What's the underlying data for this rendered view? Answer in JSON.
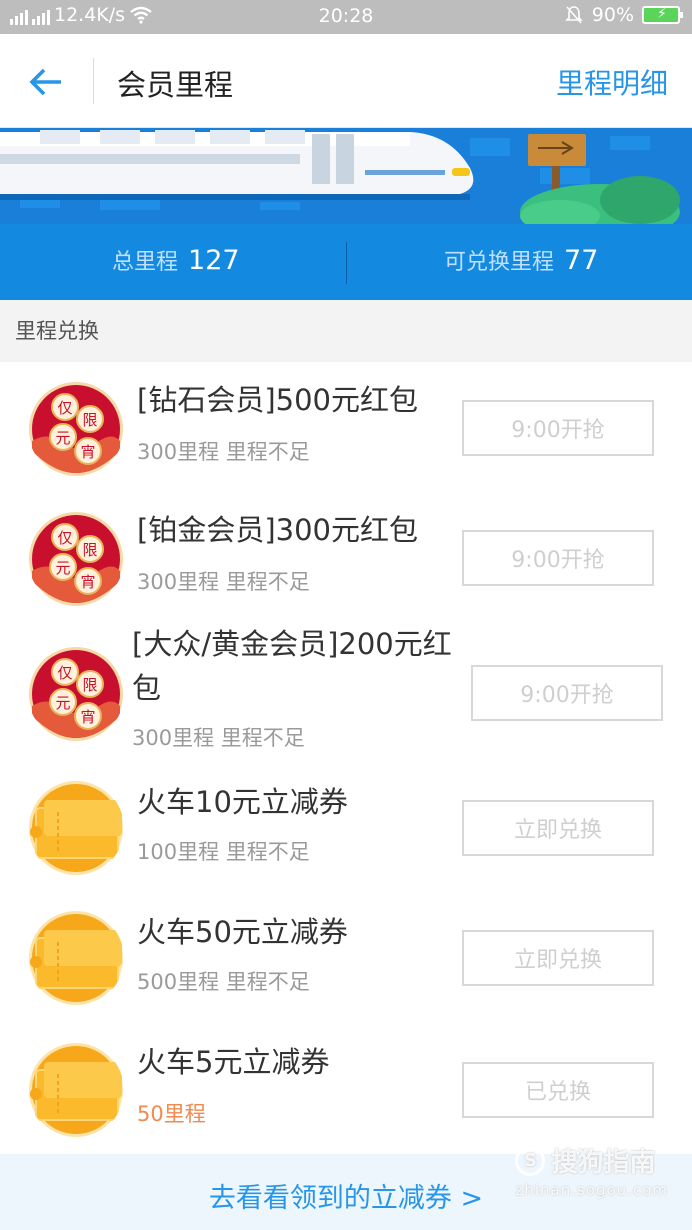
{
  "status_bar": {
    "network_1": "4G",
    "network_2": "2G",
    "speed": "12.4K/s",
    "time": "20:28",
    "battery": "90%"
  },
  "header": {
    "title": "会员里程",
    "detail_link": "里程明细"
  },
  "stats": {
    "total_label": "总里程",
    "total_value": "127",
    "exchangeable_label": "可兑换里程",
    "exchangeable_value": "77"
  },
  "section": {
    "title": "里程兑换"
  },
  "items": [
    {
      "name": "[钻石会员]500元红包",
      "miles": "300里程",
      "status": "里程不足",
      "button": "9:00开抢",
      "badge_icon": "red-envelope-badge",
      "badge_chars": [
        "仅",
        "限",
        "元",
        "宵"
      ]
    },
    {
      "name": "[铂金会员]300元红包",
      "miles": "300里程",
      "status": "里程不足",
      "button": "9:00开抢",
      "badge_icon": "red-envelope-badge",
      "badge_chars": [
        "仅",
        "限",
        "元",
        "宵"
      ]
    },
    {
      "name": "[大众/黄金会员]200元红包",
      "miles": "300里程",
      "status": "里程不足",
      "button": "9:00开抢",
      "badge_icon": "red-envelope-badge",
      "badge_chars": [
        "仅",
        "限",
        "元",
        "宵"
      ]
    },
    {
      "name": "火车10元立减券",
      "miles": "100里程",
      "status": "里程不足",
      "button": "立即兑换",
      "badge_icon": "ticket-coupon-badge"
    },
    {
      "name": "火车50元立减券",
      "miles": "500里程",
      "status": "里程不足",
      "button": "立即兑换",
      "badge_icon": "ticket-coupon-badge"
    },
    {
      "name": "火车5元立减券",
      "miles": "50里程",
      "status": "",
      "button": "已兑换",
      "badge_icon": "ticket-coupon-badge"
    }
  ],
  "footer": {
    "link": "去看看领到的立减券 >"
  },
  "watermark": {
    "main": "搜狗指南",
    "sub": "zhinan.sogou.com"
  },
  "colors": {
    "accent": "#2796e8",
    "banner_blue": "#1489e0",
    "badge_red": "#c8102e",
    "badge_gold": "#f6a81a",
    "highlight_orange": "#f08a4e"
  }
}
